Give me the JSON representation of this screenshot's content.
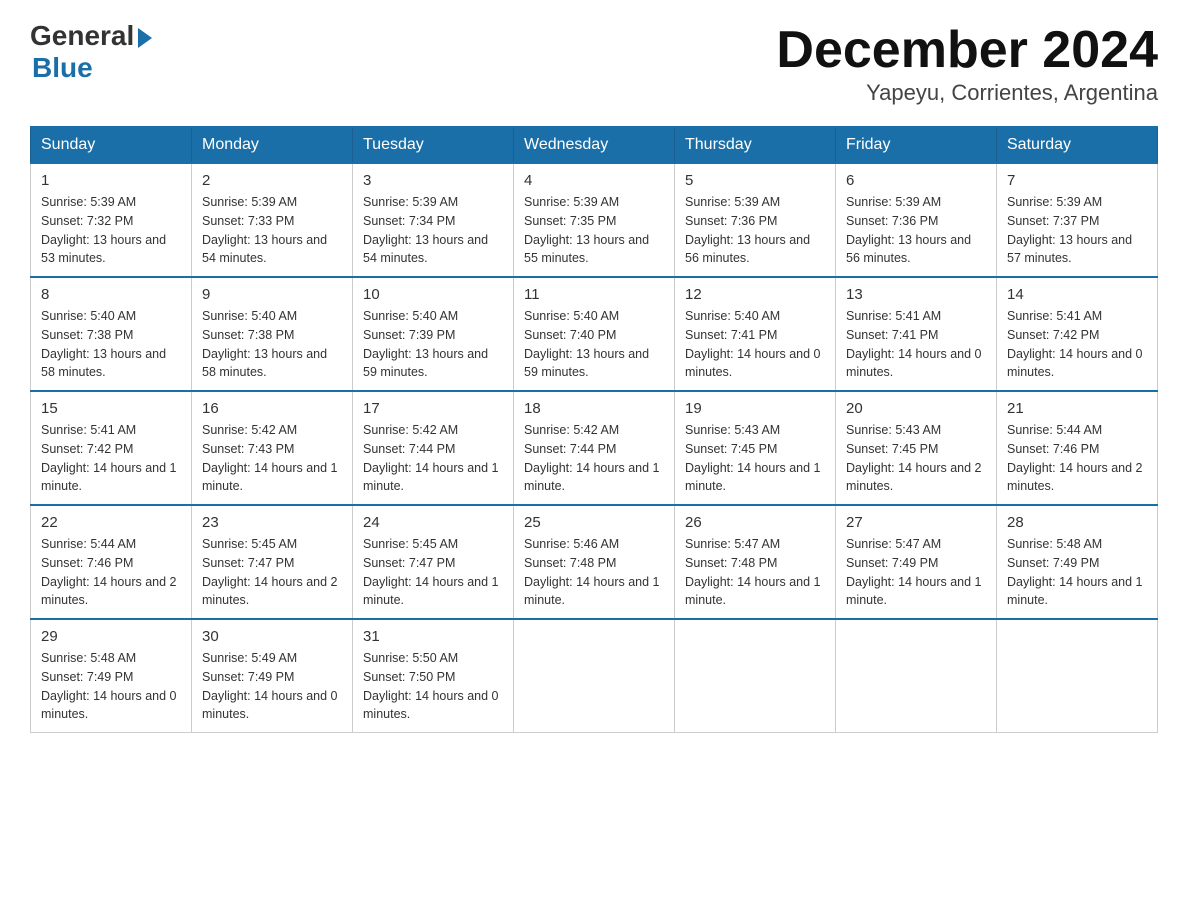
{
  "logo": {
    "general": "General",
    "blue": "Blue"
  },
  "header": {
    "month": "December 2024",
    "location": "Yapeyu, Corrientes, Argentina"
  },
  "days_of_week": [
    "Sunday",
    "Monday",
    "Tuesday",
    "Wednesday",
    "Thursday",
    "Friday",
    "Saturday"
  ],
  "weeks": [
    [
      {
        "day": "1",
        "sunrise": "5:39 AM",
        "sunset": "7:32 PM",
        "daylight": "13 hours and 53 minutes."
      },
      {
        "day": "2",
        "sunrise": "5:39 AM",
        "sunset": "7:33 PM",
        "daylight": "13 hours and 54 minutes."
      },
      {
        "day": "3",
        "sunrise": "5:39 AM",
        "sunset": "7:34 PM",
        "daylight": "13 hours and 54 minutes."
      },
      {
        "day": "4",
        "sunrise": "5:39 AM",
        "sunset": "7:35 PM",
        "daylight": "13 hours and 55 minutes."
      },
      {
        "day": "5",
        "sunrise": "5:39 AM",
        "sunset": "7:36 PM",
        "daylight": "13 hours and 56 minutes."
      },
      {
        "day": "6",
        "sunrise": "5:39 AM",
        "sunset": "7:36 PM",
        "daylight": "13 hours and 56 minutes."
      },
      {
        "day": "7",
        "sunrise": "5:39 AM",
        "sunset": "7:37 PM",
        "daylight": "13 hours and 57 minutes."
      }
    ],
    [
      {
        "day": "8",
        "sunrise": "5:40 AM",
        "sunset": "7:38 PM",
        "daylight": "13 hours and 58 minutes."
      },
      {
        "day": "9",
        "sunrise": "5:40 AM",
        "sunset": "7:38 PM",
        "daylight": "13 hours and 58 minutes."
      },
      {
        "day": "10",
        "sunrise": "5:40 AM",
        "sunset": "7:39 PM",
        "daylight": "13 hours and 59 minutes."
      },
      {
        "day": "11",
        "sunrise": "5:40 AM",
        "sunset": "7:40 PM",
        "daylight": "13 hours and 59 minutes."
      },
      {
        "day": "12",
        "sunrise": "5:40 AM",
        "sunset": "7:41 PM",
        "daylight": "14 hours and 0 minutes."
      },
      {
        "day": "13",
        "sunrise": "5:41 AM",
        "sunset": "7:41 PM",
        "daylight": "14 hours and 0 minutes."
      },
      {
        "day": "14",
        "sunrise": "5:41 AM",
        "sunset": "7:42 PM",
        "daylight": "14 hours and 0 minutes."
      }
    ],
    [
      {
        "day": "15",
        "sunrise": "5:41 AM",
        "sunset": "7:42 PM",
        "daylight": "14 hours and 1 minute."
      },
      {
        "day": "16",
        "sunrise": "5:42 AM",
        "sunset": "7:43 PM",
        "daylight": "14 hours and 1 minute."
      },
      {
        "day": "17",
        "sunrise": "5:42 AM",
        "sunset": "7:44 PM",
        "daylight": "14 hours and 1 minute."
      },
      {
        "day": "18",
        "sunrise": "5:42 AM",
        "sunset": "7:44 PM",
        "daylight": "14 hours and 1 minute."
      },
      {
        "day": "19",
        "sunrise": "5:43 AM",
        "sunset": "7:45 PM",
        "daylight": "14 hours and 1 minute."
      },
      {
        "day": "20",
        "sunrise": "5:43 AM",
        "sunset": "7:45 PM",
        "daylight": "14 hours and 2 minutes."
      },
      {
        "day": "21",
        "sunrise": "5:44 AM",
        "sunset": "7:46 PM",
        "daylight": "14 hours and 2 minutes."
      }
    ],
    [
      {
        "day": "22",
        "sunrise": "5:44 AM",
        "sunset": "7:46 PM",
        "daylight": "14 hours and 2 minutes."
      },
      {
        "day": "23",
        "sunrise": "5:45 AM",
        "sunset": "7:47 PM",
        "daylight": "14 hours and 2 minutes."
      },
      {
        "day": "24",
        "sunrise": "5:45 AM",
        "sunset": "7:47 PM",
        "daylight": "14 hours and 1 minute."
      },
      {
        "day": "25",
        "sunrise": "5:46 AM",
        "sunset": "7:48 PM",
        "daylight": "14 hours and 1 minute."
      },
      {
        "day": "26",
        "sunrise": "5:47 AM",
        "sunset": "7:48 PM",
        "daylight": "14 hours and 1 minute."
      },
      {
        "day": "27",
        "sunrise": "5:47 AM",
        "sunset": "7:49 PM",
        "daylight": "14 hours and 1 minute."
      },
      {
        "day": "28",
        "sunrise": "5:48 AM",
        "sunset": "7:49 PM",
        "daylight": "14 hours and 1 minute."
      }
    ],
    [
      {
        "day": "29",
        "sunrise": "5:48 AM",
        "sunset": "7:49 PM",
        "daylight": "14 hours and 0 minutes."
      },
      {
        "day": "30",
        "sunrise": "5:49 AM",
        "sunset": "7:49 PM",
        "daylight": "14 hours and 0 minutes."
      },
      {
        "day": "31",
        "sunrise": "5:50 AM",
        "sunset": "7:50 PM",
        "daylight": "14 hours and 0 minutes."
      },
      null,
      null,
      null,
      null
    ]
  ]
}
